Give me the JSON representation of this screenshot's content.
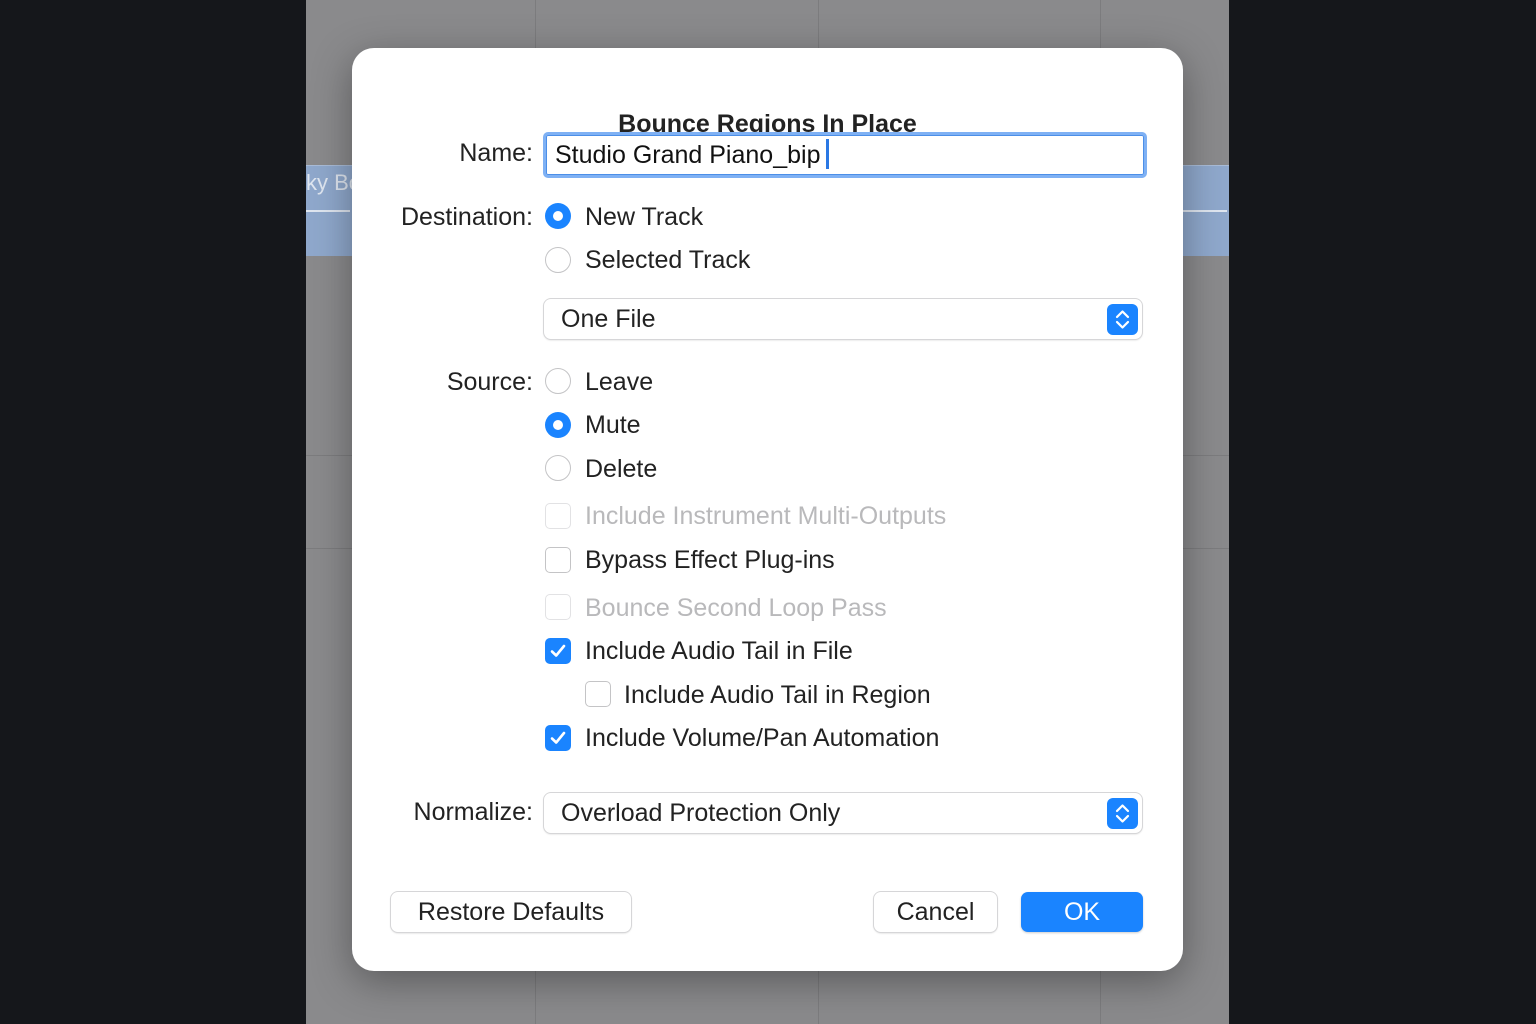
{
  "background": {
    "region_label": "ky Bo"
  },
  "dialog": {
    "title": "Bounce Regions In Place",
    "name": {
      "label": "Name:",
      "value": "Studio Grand Piano_bip"
    },
    "destination": {
      "label": "Destination:",
      "options": [
        {
          "label": "New Track",
          "selected": true
        },
        {
          "label": "Selected Track",
          "selected": false
        }
      ]
    },
    "file_mode": {
      "value": "One File"
    },
    "source": {
      "label": "Source:",
      "options": [
        {
          "label": "Leave",
          "selected": false
        },
        {
          "label": "Mute",
          "selected": true
        },
        {
          "label": "Delete",
          "selected": false
        }
      ]
    },
    "checkboxes": [
      {
        "label": "Include Instrument Multi-Outputs",
        "checked": false,
        "enabled": false
      },
      {
        "label": "Bypass Effect Plug-ins",
        "checked": false,
        "enabled": true
      },
      {
        "label": "Bounce Second Loop Pass",
        "checked": false,
        "enabled": false
      },
      {
        "label": "Include Audio Tail in File",
        "checked": true,
        "enabled": true
      },
      {
        "label": "Include Audio Tail in Region",
        "checked": false,
        "enabled": true
      },
      {
        "label": "Include Volume/Pan Automation",
        "checked": true,
        "enabled": true
      }
    ],
    "normalize": {
      "label": "Normalize:",
      "value": "Overload Protection Only"
    },
    "buttons": {
      "restore_defaults": "Restore Defaults",
      "cancel": "Cancel",
      "ok": "OK"
    }
  },
  "colors": {
    "accent": "#1a84ff",
    "focus_ring": "#7fb1f4",
    "disabled_text": "#b9b9bb"
  }
}
